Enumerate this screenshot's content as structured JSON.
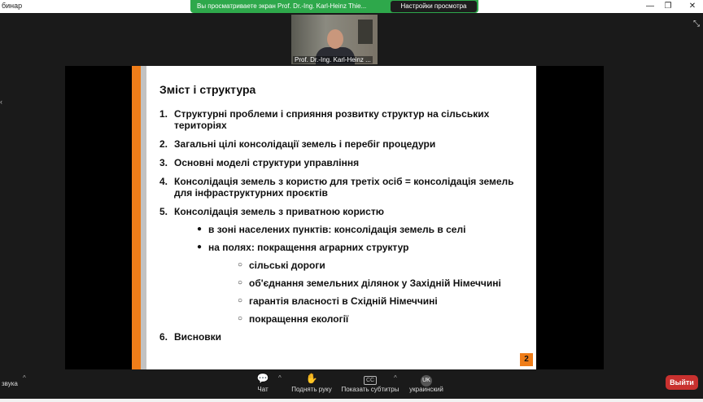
{
  "window": {
    "title": "бинар"
  },
  "share_banner": {
    "text": "Вы просматриваете экран Prof. Dr.-Ing. Karl-Heinz Thie...",
    "view_button": "Настройки просмотра"
  },
  "video": {
    "name": "Prof. Dr.-Ing. Karl-Heinz ..."
  },
  "slide": {
    "title": "Зміст і структура",
    "page": "2",
    "items": [
      {
        "num": "1.",
        "text": "Структурні проблеми і сприяння розвитку структур на сільських територіях"
      },
      {
        "num": "2.",
        "text": "Загальні цілі консолідації земель і перебіг процедури"
      },
      {
        "num": "3.",
        "text": "Основні моделі структури управління"
      },
      {
        "num": "4.",
        "text": "Консолідація земель з користю для третіх осіб = консолідація земель для інфраструктурних проєктів"
      },
      {
        "num": "5.",
        "text": "Консолідація земель з приватною користю"
      },
      {
        "bullet": "●",
        "text": "в зоні населених пунктів: консолідація земель в селі"
      },
      {
        "bullet": "●",
        "text": "на полях: покращення аграрних структур"
      },
      {
        "bullet": "○",
        "text": "сільські дороги"
      },
      {
        "bullet": "○",
        "text": "об'єднання земельних ділянок у Західній Німеччині"
      },
      {
        "bullet": "○",
        "text": "гарантія власності в Східній Німеччині"
      },
      {
        "bullet": "○",
        "text": "покращення екології"
      },
      {
        "num": "6.",
        "text": "Висновки"
      }
    ]
  },
  "toolbar": {
    "audio_label": "звука",
    "chat": "Чат",
    "raise_hand": "Поднять руку",
    "captions": "Показать субтитры",
    "captions_icon_text": "CC",
    "language_icon_text": "UK",
    "language": "украинский",
    "leave": "Выйти"
  }
}
